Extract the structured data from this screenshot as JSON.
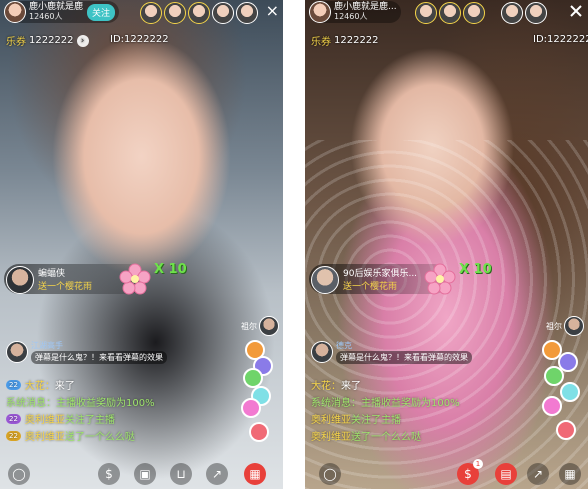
{
  "left": {
    "host": {
      "name": "鹿小鹿就是鹿",
      "fans": "12460人",
      "follow_label": "关注"
    },
    "close_icon": "×",
    "lequan": {
      "label": "乐券",
      "value": "1222222"
    },
    "room_id": "ID:1222222",
    "gift": {
      "sender": "蝙蝠侠",
      "desc": "送一个樱花雨",
      "count": "X 10"
    },
    "danmaku": {
      "user": "江湖高手",
      "text": "弹幕是什么鬼？！来看看弹幕的效果"
    },
    "corner_user": "祖尔",
    "chat": [
      {
        "level": "22",
        "user": "大花：",
        "text": "来了",
        "badge": "blue"
      },
      {
        "level": "",
        "user": "系统消息：",
        "text": "主播收益奖励为100%",
        "badge": "none"
      },
      {
        "level": "22",
        "user": "奥利维亚",
        "text": "关注了主播",
        "badge": "purple"
      },
      {
        "level": "22",
        "user": "奥利维亚",
        "text": "送了一个么么哒",
        "badge": "gold"
      }
    ],
    "toolbar": [
      "chat-icon",
      "money-bag-icon",
      "shop-icon",
      "cart-icon",
      "share-icon",
      "gift-icon"
    ]
  },
  "right": {
    "host": {
      "name": "鹿小鹿就是鹿...",
      "fans": "12460人"
    },
    "lequan": {
      "label": "乐券",
      "value": "1222222"
    },
    "room_id": "ID:1222222",
    "gift": {
      "sender": "90后娱乐家俱乐...",
      "desc": "送一个樱花雨",
      "count": "X 10"
    },
    "danmaku": {
      "user": "德克",
      "text": "弹幕是什么鬼？！来看看弹幕的效果"
    },
    "corner_user": "祖尔",
    "chat": [
      {
        "user": "大花：",
        "text": "来了"
      },
      {
        "user": "系统消息：",
        "text": "主播收益奖励为100%"
      },
      {
        "user": "奥利维亚",
        "text": "关注了主播"
      },
      {
        "user": "奥利维亚",
        "text": "送了一个么么哒"
      }
    ],
    "toolbar_badge": "1"
  },
  "colors": {
    "follow": "#3ec3c5",
    "username": "#f5d44a",
    "system": "#9ee56b",
    "count": "#6ee24a",
    "gift_button": "#e8403a"
  }
}
